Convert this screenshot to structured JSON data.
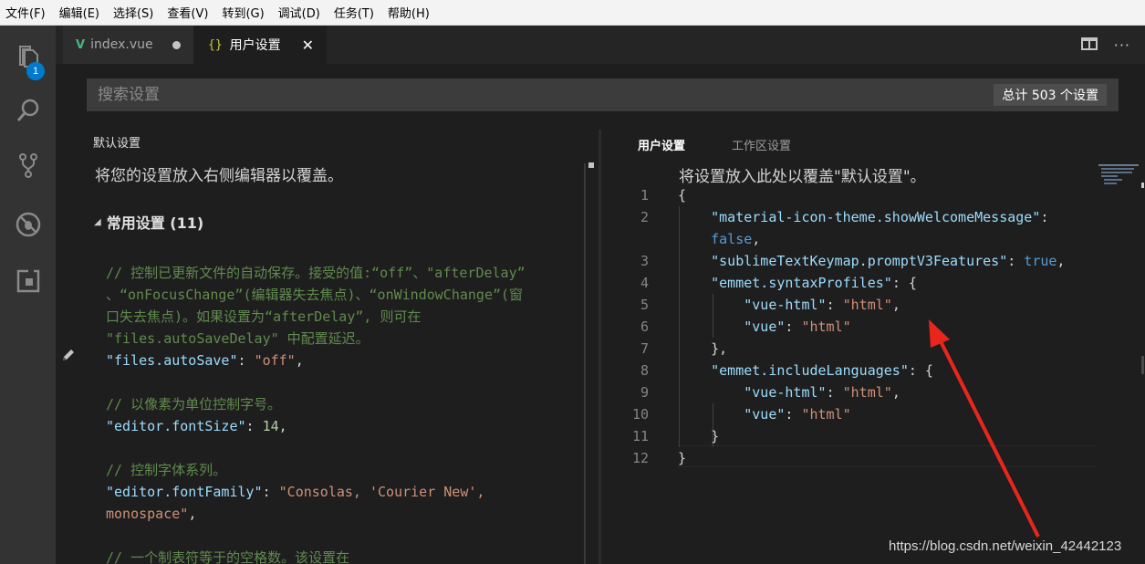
{
  "menubar": {
    "items": [
      "文件(F)",
      "编辑(E)",
      "选择(S)",
      "查看(V)",
      "转到(G)",
      "调试(D)",
      "任务(T)",
      "帮助(H)"
    ]
  },
  "activitybar": {
    "items": [
      {
        "icon": "files-icon",
        "badge": "1"
      },
      {
        "icon": "search-icon"
      },
      {
        "icon": "source-control-icon"
      },
      {
        "icon": "debug-icon"
      },
      {
        "icon": "extensions-icon"
      }
    ]
  },
  "tabs": [
    {
      "label": "index.vue",
      "icon": "vue-file-icon",
      "dirty": true
    },
    {
      "label": "用户设置",
      "icon": "json-file-icon",
      "logo": "{}",
      "active": true
    }
  ],
  "search": {
    "placeholder": "搜索设置",
    "count_label": "总计 503 个设置"
  },
  "default_settings": {
    "title": "默认设置",
    "hint": "将您的设置放入右侧编辑器以覆盖。",
    "section": "常用设置 (11)",
    "lines": [
      [
        {
          "t": "// 控制已更新文件的自动保存。接受的值:“off”、\"afterDelay”",
          "c": "cm"
        }
      ],
      [
        {
          "t": "、“onFocusChange”(编辑器失去焦点)、“onWindowChange”(窗",
          "c": "cm"
        }
      ],
      [
        {
          "t": "口失去焦点)。如果设置为“afterDelay”, 则可在",
          "c": "cm"
        }
      ],
      [
        {
          "t": "\"files.autoSaveDelay\" 中配置延迟。",
          "c": "cm"
        }
      ],
      [
        {
          "t": "\"files.autoSave\"",
          "c": "k"
        },
        {
          "t": ": ",
          "c": "p"
        },
        {
          "t": "\"off\"",
          "c": "s"
        },
        {
          "t": ",",
          "c": "p"
        }
      ],
      [
        {
          "t": "",
          "c": "p"
        }
      ],
      [
        {
          "t": "// 以像素为单位控制字号。",
          "c": "cm"
        }
      ],
      [
        {
          "t": "\"editor.fontSize\"",
          "c": "k"
        },
        {
          "t": ": ",
          "c": "p"
        },
        {
          "t": "14",
          "c": "n"
        },
        {
          "t": ",",
          "c": "p"
        }
      ],
      [
        {
          "t": "",
          "c": "p"
        }
      ],
      [
        {
          "t": "// 控制字体系列。",
          "c": "cm"
        }
      ],
      [
        {
          "t": "\"editor.fontFamily\"",
          "c": "k"
        },
        {
          "t": ": ",
          "c": "p"
        },
        {
          "t": "\"Consolas, 'Courier New',",
          "c": "s"
        }
      ],
      [
        {
          "t": "monospace\"",
          "c": "s"
        },
        {
          "t": ",",
          "c": "p"
        }
      ],
      [
        {
          "t": "",
          "c": "p"
        }
      ],
      [
        {
          "t": "// 一个制表符等于的空格数。该设置在",
          "c": "cm"
        }
      ]
    ]
  },
  "user_settings": {
    "tab_user": "用户设置",
    "tab_workspace": "工作区设置",
    "hint": "将设置放入此处以覆盖\"默认设置\"。",
    "lines": [
      {
        "n": "1",
        "segs": [
          {
            "t": "{",
            "c": "p"
          }
        ]
      },
      {
        "n": "2",
        "segs": [
          {
            "t": "    ",
            "c": "p"
          },
          {
            "t": "\"material-icon-theme.showWelcomeMessage\"",
            "c": "k"
          },
          {
            "t": ":",
            "c": "p"
          }
        ]
      },
      {
        "n": "",
        "segs": [
          {
            "t": "    ",
            "c": "p"
          },
          {
            "t": "false",
            "c": "b"
          },
          {
            "t": ",",
            "c": "p"
          }
        ]
      },
      {
        "n": "3",
        "segs": [
          {
            "t": "    ",
            "c": "p"
          },
          {
            "t": "\"sublimeTextKeymap.promptV3Features\"",
            "c": "k"
          },
          {
            "t": ": ",
            "c": "p"
          },
          {
            "t": "true",
            "c": "b"
          },
          {
            "t": ",",
            "c": "p"
          }
        ]
      },
      {
        "n": "4",
        "segs": [
          {
            "t": "    ",
            "c": "p"
          },
          {
            "t": "\"emmet.syntaxProfiles\"",
            "c": "k"
          },
          {
            "t": ": {",
            "c": "p"
          }
        ]
      },
      {
        "n": "5",
        "segs": [
          {
            "t": "        ",
            "c": "p"
          },
          {
            "t": "\"vue-html\"",
            "c": "k"
          },
          {
            "t": ": ",
            "c": "p"
          },
          {
            "t": "\"html\"",
            "c": "s"
          },
          {
            "t": ",",
            "c": "p"
          }
        ]
      },
      {
        "n": "6",
        "segs": [
          {
            "t": "        ",
            "c": "p"
          },
          {
            "t": "\"vue\"",
            "c": "k"
          },
          {
            "t": ": ",
            "c": "p"
          },
          {
            "t": "\"html\"",
            "c": "s"
          }
        ]
      },
      {
        "n": "7",
        "segs": [
          {
            "t": "    },",
            "c": "p"
          }
        ]
      },
      {
        "n": "8",
        "segs": [
          {
            "t": "    ",
            "c": "p"
          },
          {
            "t": "\"emmet.includeLanguages\"",
            "c": "k"
          },
          {
            "t": ": {",
            "c": "p"
          }
        ]
      },
      {
        "n": "9",
        "segs": [
          {
            "t": "        ",
            "c": "p"
          },
          {
            "t": "\"vue-html\"",
            "c": "k"
          },
          {
            "t": ": ",
            "c": "p"
          },
          {
            "t": "\"html\"",
            "c": "s"
          },
          {
            "t": ",",
            "c": "p"
          }
        ]
      },
      {
        "n": "10",
        "segs": [
          {
            "t": "        ",
            "c": "p"
          },
          {
            "t": "\"vue\"",
            "c": "k"
          },
          {
            "t": ": ",
            "c": "p"
          },
          {
            "t": "\"html\"",
            "c": "s"
          }
        ]
      },
      {
        "n": "11",
        "segs": [
          {
            "t": "    }",
            "c": "p"
          }
        ]
      },
      {
        "n": "12",
        "segs": [
          {
            "t": "}",
            "c": "p"
          }
        ]
      }
    ]
  },
  "colors": {
    "accent": "#007acc",
    "annotation_arrow": "#e8261c",
    "comment": "#608b4e",
    "key": "#9cdcfe",
    "string": "#ce9178",
    "number": "#b5cea8",
    "boolean": "#569cd6"
  },
  "watermark": "https://blog.csdn.net/weixin_42442123"
}
